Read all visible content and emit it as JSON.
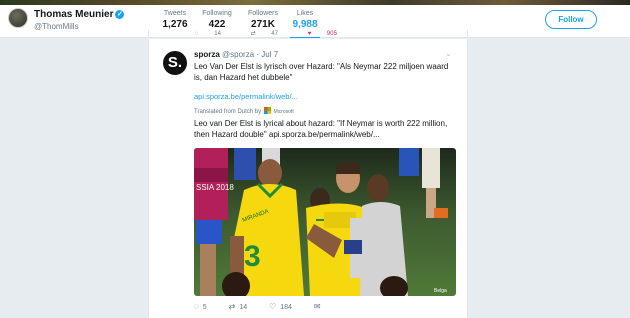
{
  "profile": {
    "name": "Thomas Meunier",
    "handle": "@ThomMills",
    "stats": [
      {
        "label": "Tweets",
        "value": "1,276"
      },
      {
        "label": "Following",
        "value": "422"
      },
      {
        "label": "Followers",
        "value": "271K"
      },
      {
        "label": "Likes",
        "value": "9,988"
      }
    ],
    "follow_label": "Follow"
  },
  "prev_tweet_actions": {
    "replies": "14",
    "retweets": "47",
    "likes": "905"
  },
  "tweet": {
    "author_name": "sporza",
    "author_handle": "@sporza",
    "date": "· Jul 7",
    "avatar_letter": "S.",
    "text": "Leo Van Der Elst is lyrisch over Hazard: \"Als Neymar 222 miljoen waard is, dan Hazard het dubbele\"",
    "link": "api.sporza.be/permalink/web/...",
    "translated_from": "Translated from Dutch by",
    "translator": "Microsoft",
    "translation": "Leo van Der Elst is lyrical about hazard: \"If Neymar is worth 222 million, then Hazard double\" api.sporza.be/permalink/web/...",
    "photo": {
      "banner_text": "SSIA 2018",
      "jersey_name": "MIRANDA",
      "jersey_number": "3",
      "credit": "Belga"
    },
    "actions": {
      "replies": "5",
      "retweets": "14",
      "likes": "184"
    }
  },
  "colors": {
    "accent": "#1da1f2",
    "like": "#e0245e",
    "muted": "#657786"
  }
}
